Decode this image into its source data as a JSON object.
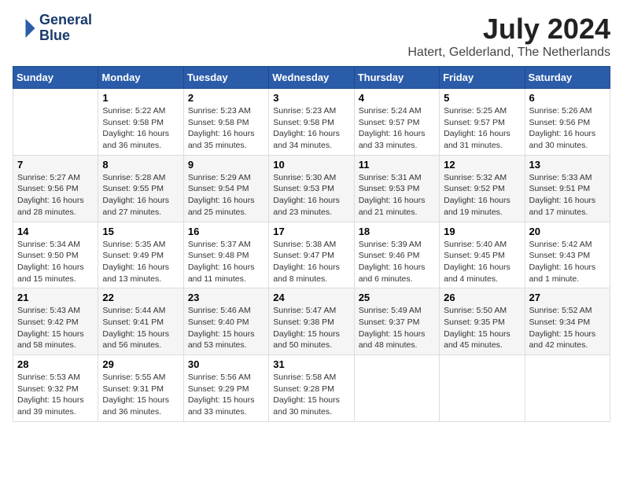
{
  "logo": {
    "line1": "General",
    "line2": "Blue"
  },
  "title": "July 2024",
  "location": "Hatert, Gelderland, The Netherlands",
  "days_of_week": [
    "Sunday",
    "Monday",
    "Tuesday",
    "Wednesday",
    "Thursday",
    "Friday",
    "Saturday"
  ],
  "weeks": [
    [
      {
        "day": "",
        "info": ""
      },
      {
        "day": "1",
        "info": "Sunrise: 5:22 AM\nSunset: 9:58 PM\nDaylight: 16 hours\nand 36 minutes."
      },
      {
        "day": "2",
        "info": "Sunrise: 5:23 AM\nSunset: 9:58 PM\nDaylight: 16 hours\nand 35 minutes."
      },
      {
        "day": "3",
        "info": "Sunrise: 5:23 AM\nSunset: 9:58 PM\nDaylight: 16 hours\nand 34 minutes."
      },
      {
        "day": "4",
        "info": "Sunrise: 5:24 AM\nSunset: 9:57 PM\nDaylight: 16 hours\nand 33 minutes."
      },
      {
        "day": "5",
        "info": "Sunrise: 5:25 AM\nSunset: 9:57 PM\nDaylight: 16 hours\nand 31 minutes."
      },
      {
        "day": "6",
        "info": "Sunrise: 5:26 AM\nSunset: 9:56 PM\nDaylight: 16 hours\nand 30 minutes."
      }
    ],
    [
      {
        "day": "7",
        "info": "Sunrise: 5:27 AM\nSunset: 9:56 PM\nDaylight: 16 hours\nand 28 minutes."
      },
      {
        "day": "8",
        "info": "Sunrise: 5:28 AM\nSunset: 9:55 PM\nDaylight: 16 hours\nand 27 minutes."
      },
      {
        "day": "9",
        "info": "Sunrise: 5:29 AM\nSunset: 9:54 PM\nDaylight: 16 hours\nand 25 minutes."
      },
      {
        "day": "10",
        "info": "Sunrise: 5:30 AM\nSunset: 9:53 PM\nDaylight: 16 hours\nand 23 minutes."
      },
      {
        "day": "11",
        "info": "Sunrise: 5:31 AM\nSunset: 9:53 PM\nDaylight: 16 hours\nand 21 minutes."
      },
      {
        "day": "12",
        "info": "Sunrise: 5:32 AM\nSunset: 9:52 PM\nDaylight: 16 hours\nand 19 minutes."
      },
      {
        "day": "13",
        "info": "Sunrise: 5:33 AM\nSunset: 9:51 PM\nDaylight: 16 hours\nand 17 minutes."
      }
    ],
    [
      {
        "day": "14",
        "info": "Sunrise: 5:34 AM\nSunset: 9:50 PM\nDaylight: 16 hours\nand 15 minutes."
      },
      {
        "day": "15",
        "info": "Sunrise: 5:35 AM\nSunset: 9:49 PM\nDaylight: 16 hours\nand 13 minutes."
      },
      {
        "day": "16",
        "info": "Sunrise: 5:37 AM\nSunset: 9:48 PM\nDaylight: 16 hours\nand 11 minutes."
      },
      {
        "day": "17",
        "info": "Sunrise: 5:38 AM\nSunset: 9:47 PM\nDaylight: 16 hours\nand 8 minutes."
      },
      {
        "day": "18",
        "info": "Sunrise: 5:39 AM\nSunset: 9:46 PM\nDaylight: 16 hours\nand 6 minutes."
      },
      {
        "day": "19",
        "info": "Sunrise: 5:40 AM\nSunset: 9:45 PM\nDaylight: 16 hours\nand 4 minutes."
      },
      {
        "day": "20",
        "info": "Sunrise: 5:42 AM\nSunset: 9:43 PM\nDaylight: 16 hours\nand 1 minute."
      }
    ],
    [
      {
        "day": "21",
        "info": "Sunrise: 5:43 AM\nSunset: 9:42 PM\nDaylight: 15 hours\nand 58 minutes."
      },
      {
        "day": "22",
        "info": "Sunrise: 5:44 AM\nSunset: 9:41 PM\nDaylight: 15 hours\nand 56 minutes."
      },
      {
        "day": "23",
        "info": "Sunrise: 5:46 AM\nSunset: 9:40 PM\nDaylight: 15 hours\nand 53 minutes."
      },
      {
        "day": "24",
        "info": "Sunrise: 5:47 AM\nSunset: 9:38 PM\nDaylight: 15 hours\nand 50 minutes."
      },
      {
        "day": "25",
        "info": "Sunrise: 5:49 AM\nSunset: 9:37 PM\nDaylight: 15 hours\nand 48 minutes."
      },
      {
        "day": "26",
        "info": "Sunrise: 5:50 AM\nSunset: 9:35 PM\nDaylight: 15 hours\nand 45 minutes."
      },
      {
        "day": "27",
        "info": "Sunrise: 5:52 AM\nSunset: 9:34 PM\nDaylight: 15 hours\nand 42 minutes."
      }
    ],
    [
      {
        "day": "28",
        "info": "Sunrise: 5:53 AM\nSunset: 9:32 PM\nDaylight: 15 hours\nand 39 minutes."
      },
      {
        "day": "29",
        "info": "Sunrise: 5:55 AM\nSunset: 9:31 PM\nDaylight: 15 hours\nand 36 minutes."
      },
      {
        "day": "30",
        "info": "Sunrise: 5:56 AM\nSunset: 9:29 PM\nDaylight: 15 hours\nand 33 minutes."
      },
      {
        "day": "31",
        "info": "Sunrise: 5:58 AM\nSunset: 9:28 PM\nDaylight: 15 hours\nand 30 minutes."
      },
      {
        "day": "",
        "info": ""
      },
      {
        "day": "",
        "info": ""
      },
      {
        "day": "",
        "info": ""
      }
    ]
  ]
}
